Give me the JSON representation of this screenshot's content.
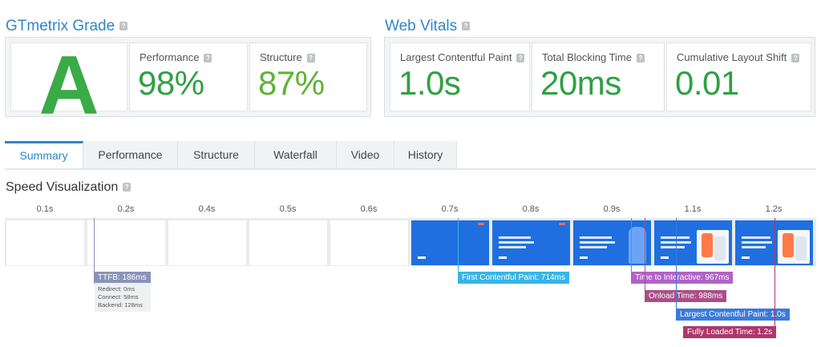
{
  "grade": {
    "title": "GTmetrix Grade",
    "help": "?",
    "letter": "A",
    "performance_label": "Performance",
    "performance_value": "98%",
    "structure_label": "Structure",
    "structure_value": "87%"
  },
  "vitals": {
    "title": "Web Vitals",
    "help": "?",
    "items": [
      {
        "label": "Largest Contentful Paint",
        "value": "1.0s"
      },
      {
        "label": "Total Blocking Time",
        "value": "20ms"
      },
      {
        "label": "Cumulative Layout Shift",
        "value": "0.01"
      }
    ]
  },
  "tabs": [
    "Summary",
    "Performance",
    "Structure",
    "Waterfall",
    "Video",
    "History"
  ],
  "active_tab": "Summary",
  "speed": {
    "title": "Speed Visualization",
    "help": "?",
    "ticks": [
      "0.1s",
      "0.2s",
      "0.4s",
      "0.5s",
      "0.6s",
      "0.7s",
      "0.8s",
      "0.9s",
      "1.1s",
      "1.2s"
    ],
    "frames": [
      {
        "kind": "blank"
      },
      {
        "kind": "blank"
      },
      {
        "kind": "blank"
      },
      {
        "kind": "blank"
      },
      {
        "kind": "blank"
      },
      {
        "kind": "blue"
      },
      {
        "kind": "blue-text"
      },
      {
        "kind": "blue-person"
      },
      {
        "kind": "blue-phone"
      },
      {
        "kind": "blue-phone"
      }
    ],
    "ttfb": {
      "label": "TTFB: 186ms",
      "redirect": "Redirect: 0ms",
      "connect": "Connect: 58ms",
      "backend": "Backend: 128ms"
    },
    "markers": [
      {
        "label": "First Contentful Paint: 714ms",
        "color": "#36b5e8"
      },
      {
        "label": "Time to Interactive: 967ms",
        "color": "#b162c6"
      },
      {
        "label": "Onload Time: 988ms",
        "color": "#a94f86"
      },
      {
        "label": "Largest Contentful Paint: 1.0s",
        "color": "#3b7bd8"
      },
      {
        "label": "Fully Loaded Time: 1.2s",
        "color": "#b0366c"
      }
    ],
    "ttfb_color": "#8a93b8"
  }
}
